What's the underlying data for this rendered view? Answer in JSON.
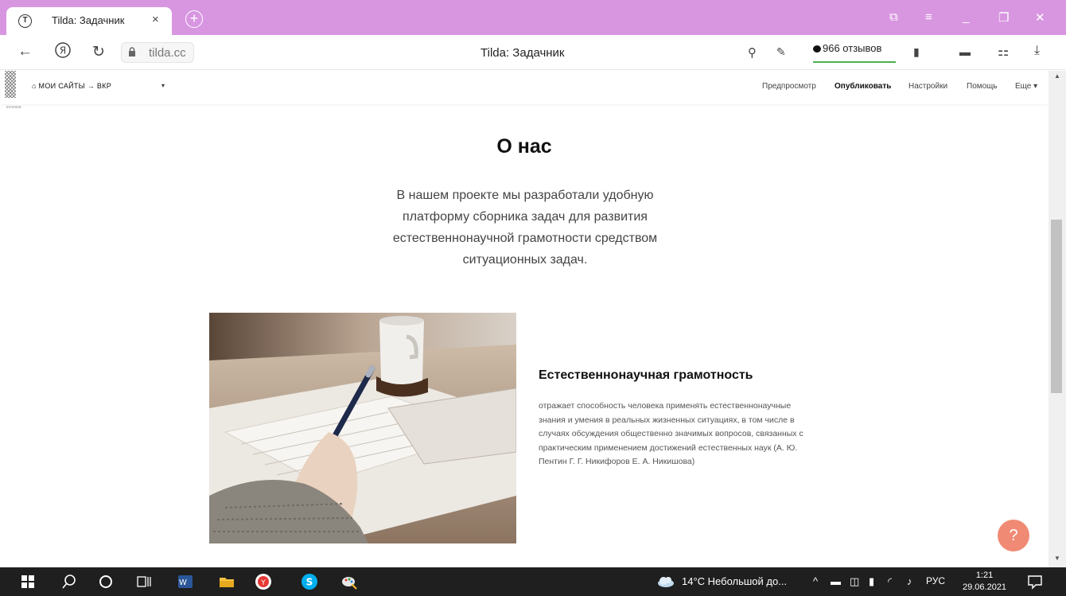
{
  "browser": {
    "tab_title": "Tilda: Задачник",
    "tab_close": "×",
    "favicon_letter": "T",
    "new_tab": "+",
    "url": "tilda.cc",
    "page_title": "Tilda: Задачник",
    "reviews": "966 отзывов",
    "accent": "#d896e1"
  },
  "tilda_header": {
    "breadcrumb": "МОИ САЙТЫ → ВКР",
    "dropdown": "▾",
    "menu": {
      "preview": "Предпросмотр",
      "publish": "Опубликовать",
      "settings": "Настройки",
      "help": "Помощь",
      "more": "Еще ▾"
    },
    "small_label": "колонки"
  },
  "content": {
    "title": "О нас",
    "intro": "В нашем проекте мы разработали удобную платформу сборника задач для развития естественнонаучной грамотности средством ситуационных задач.",
    "section_title": "Естественнонаучная грамотность",
    "section_text": "отражает способность человека применять естественнонаучные знания и умения в реальных жизненных ситуациях, в том числе в случаях обсуждения общественно значимых вопросов, связанных с практическим применением достижений естественных наук (А. Ю. Пентин Г. Г. Никифоров Е. А. Никишова)",
    "help_button": "?",
    "help_color": "#f08a74"
  },
  "taskbar": {
    "weather": "14°C  Небольшой до...",
    "language": "РУС",
    "time": "1:21",
    "date": "29.06.2021"
  }
}
